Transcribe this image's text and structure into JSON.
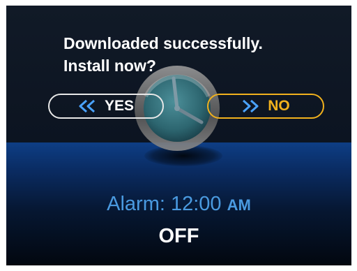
{
  "dialog": {
    "line1": "Downloaded successfully.",
    "line2": "Install now?",
    "yes_label": "YES",
    "no_label": "NO",
    "yes_icon": "rewind-icon",
    "no_icon": "fast-forward-icon"
  },
  "alarm": {
    "prefix": "Alarm: ",
    "time": "12:00",
    "period": "AM",
    "status": "OFF"
  },
  "colors": {
    "background": "#0d1522",
    "accent_blue": "#4a9ae0",
    "no_button": "#f1b11d",
    "yes_button": "#e8e8e8"
  }
}
